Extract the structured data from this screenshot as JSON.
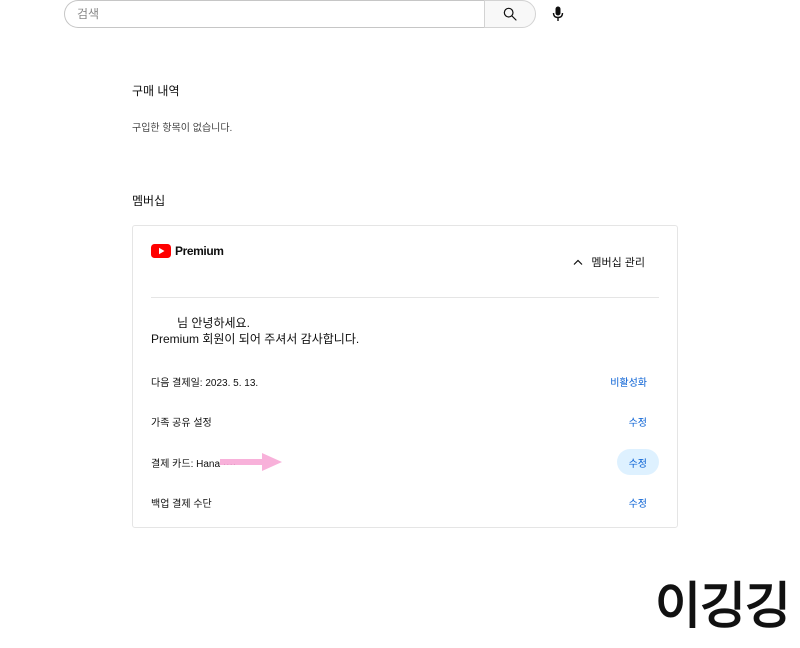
{
  "search": {
    "placeholder": "검색"
  },
  "purchases": {
    "title": "구매 내역",
    "empty_text": "구입한 항목이 없습니다."
  },
  "membership": {
    "title": "멤버십",
    "card": {
      "logo_name": "Premium",
      "manage_label": "멤버십 관리",
      "greeting_line1": "님 안녕하세요.",
      "greeting_line2": "Premium 회원이 되어 주셔서 감사합니다.",
      "rows": [
        {
          "label": "다음 결제일: 2023. 5. 13.",
          "action": "비활성화"
        },
        {
          "label": "가족 공유 설정",
          "action": "수정"
        },
        {
          "label": "결제 카드: Hana ····",
          "action": "수정"
        },
        {
          "label": "백업 결제 수단",
          "action": "수정"
        }
      ]
    }
  },
  "watermark": "이깅깅",
  "colors": {
    "accent": "#065fd4",
    "youtube_red": "#ff0000",
    "highlight": "#def1ff",
    "annotation_arrow": "#f7a8d6"
  },
  "icons": [
    "search-icon",
    "mic-icon",
    "youtube-logo-icon",
    "chevron-up-icon",
    "annotation-arrow"
  ]
}
